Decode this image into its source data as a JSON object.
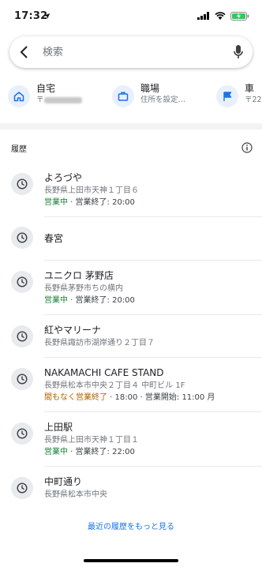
{
  "status_bar": {
    "time": "17:32"
  },
  "search": {
    "placeholder": "検索"
  },
  "shortcuts": [
    {
      "label": "自宅",
      "sub": "〒",
      "icon": "home-icon"
    },
    {
      "label": "職場",
      "sub": "住所を設定…",
      "icon": "briefcase-icon"
    },
    {
      "label": "車",
      "sub": "〒22",
      "icon": "flag-icon"
    }
  ],
  "history": {
    "title": "履歴",
    "items": [
      {
        "name": "よろづや",
        "address": "長野県上田市天神１丁目６",
        "status": "営業中",
        "detail": " · 営業終了: 20:00"
      },
      {
        "name": "春宮"
      },
      {
        "name": "ユニクロ 茅野店",
        "address": "長野県茅野市ちの横内",
        "status": "営業中",
        "detail": " · 営業終了: 20:00"
      },
      {
        "name": "紅やマリーナ",
        "address": "長野県諏訪市湖岸通り２丁目７"
      },
      {
        "name": "NAKAMACHI CAFE STAND",
        "address": "長野県松本市中央２丁目４ 中町ビル 1F",
        "status": "間もなく営業終了",
        "detail": " · 18:00 · 営業開始: 11:00 月"
      },
      {
        "name": "上田駅",
        "address": "長野県上田市天神１丁目１",
        "status": "営業中",
        "detail": " · 営業終了: 22:00"
      },
      {
        "name": "中町通り",
        "address": "長野県松本市中央"
      }
    ],
    "more_label": "最近の履歴をもっと見る"
  },
  "colors": {
    "accent": "#1a73e8",
    "open": "#188038",
    "closing_soon": "#b06000"
  }
}
